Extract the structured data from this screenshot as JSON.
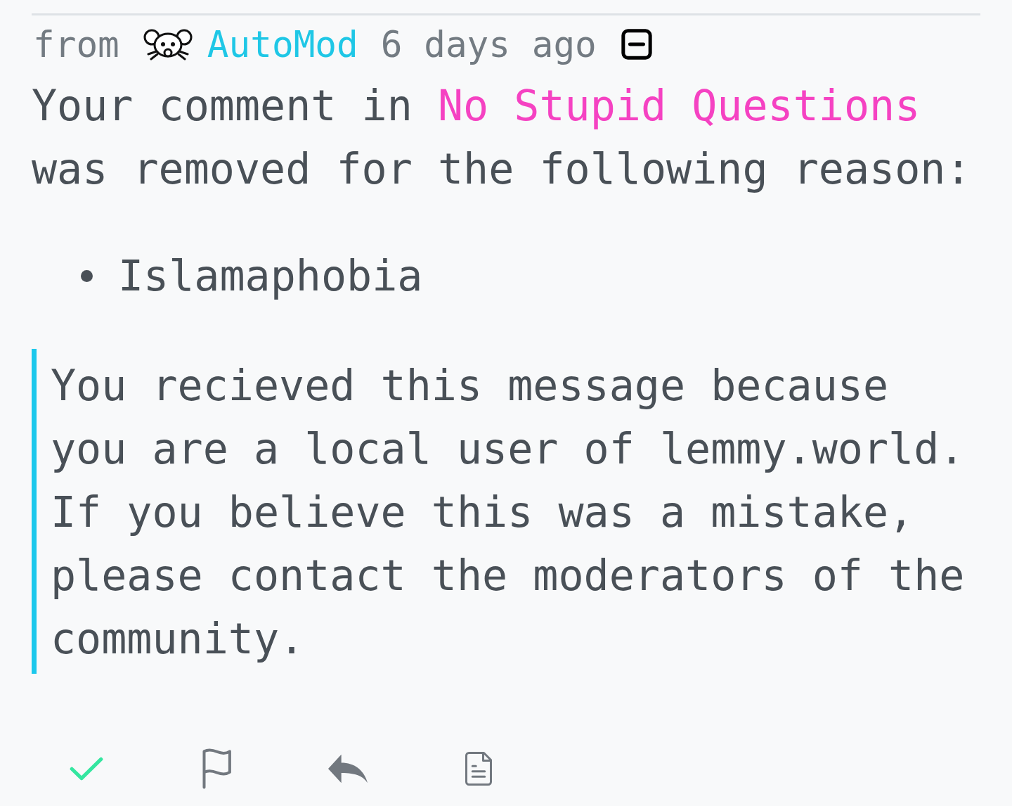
{
  "message": {
    "from_label": "from",
    "sender": "AutoMod",
    "time": "6 days ago",
    "expanded": true,
    "body": {
      "text_before": "Your comment in",
      "community": "No Stupid Questions",
      "text_after": "was removed for the following reason:"
    },
    "reasons": [
      "Islamaphobia"
    ],
    "note": "You recieved this message because you are a local user of lemmy.world. If you believe this was a mistake, please contact the moderators of the community."
  },
  "actions": [
    {
      "kind": "check",
      "on": true
    },
    {
      "kind": "flag",
      "on": false
    },
    {
      "kind": "reply",
      "on": false
    },
    {
      "kind": "document",
      "on": false
    }
  ]
}
